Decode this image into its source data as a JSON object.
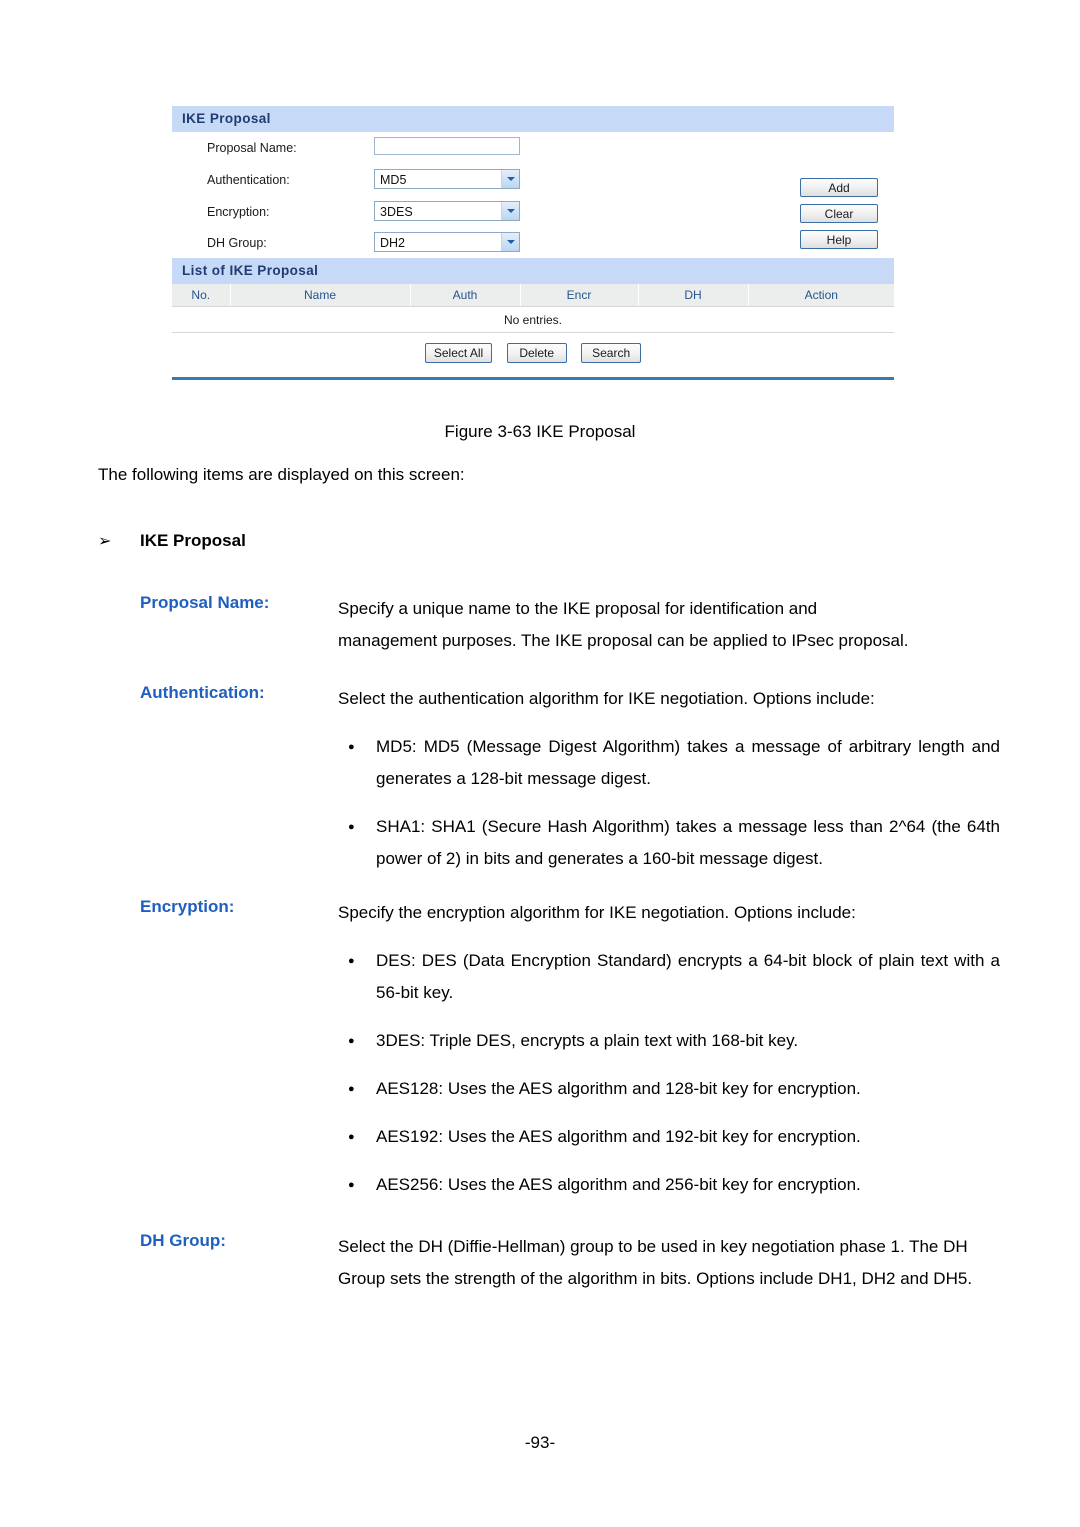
{
  "figure": {
    "panel_title": "IKE Proposal",
    "form": {
      "fields": [
        {
          "label": "Proposal Name:",
          "type": "text",
          "value": "",
          "placeholder": ""
        },
        {
          "label": "Authentication:",
          "type": "select",
          "value": "MD5"
        },
        {
          "label": "Encryption:",
          "type": "select",
          "value": "3DES"
        },
        {
          "label": "DH Group:",
          "type": "select",
          "value": "DH2"
        }
      ],
      "buttons": [
        {
          "label": "Add"
        },
        {
          "label": "Clear"
        },
        {
          "label": "Help"
        }
      ]
    },
    "list": {
      "title": "List of IKE Proposal",
      "columns": [
        "No.",
        "Name",
        "Auth",
        "Encr",
        "DH",
        "Action"
      ],
      "empty_text": "No entries.",
      "buttons": [
        {
          "label": "Select All"
        },
        {
          "label": "Delete"
        },
        {
          "label": "Search"
        }
      ]
    }
  },
  "document": {
    "figure_caption": "Figure 3-63 IKE Proposal",
    "intro": "The following items are displayed on this screen:",
    "section_heading": "IKE Proposal",
    "section_arrow": "➢",
    "definitions": [
      {
        "term": "Proposal Name:",
        "paragraphs": [
          "Specify a unique name to the IKE proposal for identification and",
          "management purposes. The IKE proposal can be applied to IPsec proposal."
        ]
      },
      {
        "term": "Authentication:",
        "paragraphs": [
          "Select the authentication algorithm for IKE negotiation. Options include:"
        ],
        "bullets": [
          "MD5: MD5 (Message Digest Algorithm) takes a message of arbitrary length and generates a 128-bit message digest.",
          "SHA1: SHA1 (Secure Hash Algorithm) takes a message less than 2^64 (the 64th power of 2) in bits and generates a 160-bit message digest."
        ]
      },
      {
        "term": "Encryption:",
        "paragraphs": [
          "Specify the encryption algorithm for IKE negotiation. Options include:"
        ],
        "bullets": [
          "DES: DES (Data Encryption Standard) encrypts a 64-bit block of plain text with a 56-bit key.",
          "3DES: Triple DES, encrypts a plain text with 168-bit key.",
          "AES128: Uses the AES algorithm and 128-bit key for encryption.",
          "AES192: Uses the AES algorithm and 192-bit key for encryption.",
          "AES256: Uses the AES algorithm and 256-bit key for encryption."
        ]
      },
      {
        "term": "DH Group:",
        "paragraphs": [
          "Select the DH (Diffie-Hellman) group to be used in key negotiation phase 1. The DH Group sets the strength of the algorithm in bits. Options include DH1, DH2 and DH5."
        ]
      }
    ],
    "page_number": "-93-"
  },
  "colors": {
    "panel_header_bg": "#c6daf7",
    "panel_header_text": "#1f3b73",
    "table_header_bg": "#eceded",
    "table_header_text": "#24558c",
    "term_blue": "#1f5fbf",
    "rule_blue": "#3a79ad"
  }
}
